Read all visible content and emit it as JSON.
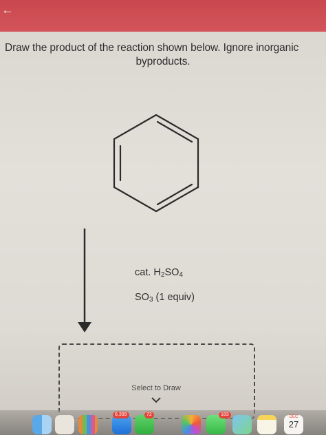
{
  "header": {
    "back_icon": "back-arrow-icon",
    "color": "#cc4a50"
  },
  "question": {
    "line1": "Draw the product of the reaction shown below. Ignore inorganic",
    "line2": "byproducts."
  },
  "reaction": {
    "starting_material": "benzene",
    "reagent1": {
      "prefix": "cat. H",
      "sub1": "2",
      "mid": "SO",
      "sub2": "4"
    },
    "reagent2": {
      "prefix": "SO",
      "sub1": "3",
      "suffix": " (1 equiv)"
    }
  },
  "answer_box": {
    "label": "Select to Draw"
  },
  "dock": {
    "icons": [
      "finder-icon",
      "contacts-icon",
      "launchpad-icon",
      "mail-icon",
      "facetime-icon",
      "photos-icon",
      "messages-icon",
      "maps-icon",
      "notes-icon",
      "calendar-icon"
    ],
    "badges": {
      "mail": "6,399",
      "facetime": "72",
      "messages": "183"
    },
    "calendar": {
      "month": "DEC",
      "day": "27"
    }
  }
}
